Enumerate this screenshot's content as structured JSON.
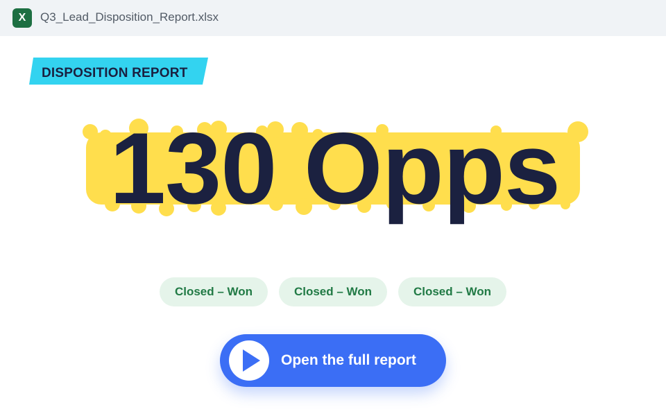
{
  "window": {
    "app_icon": "excel-icon",
    "app_icon_letter": "X",
    "filename": "Q3_Lead_Disposition_Report.xlsx"
  },
  "tag": {
    "label": "DISPOSITION REPORT",
    "color": "#33d3f0"
  },
  "headline": {
    "text": "130 Opps",
    "highlight_color": "#ffde4d"
  },
  "chips": [
    {
      "label": "Closed – Won"
    },
    {
      "label": "Closed – Won"
    },
    {
      "label": "Closed – Won"
    }
  ],
  "cta": {
    "label": "Open the full report",
    "icon": "play-icon",
    "color": "#3b6ef5"
  }
}
